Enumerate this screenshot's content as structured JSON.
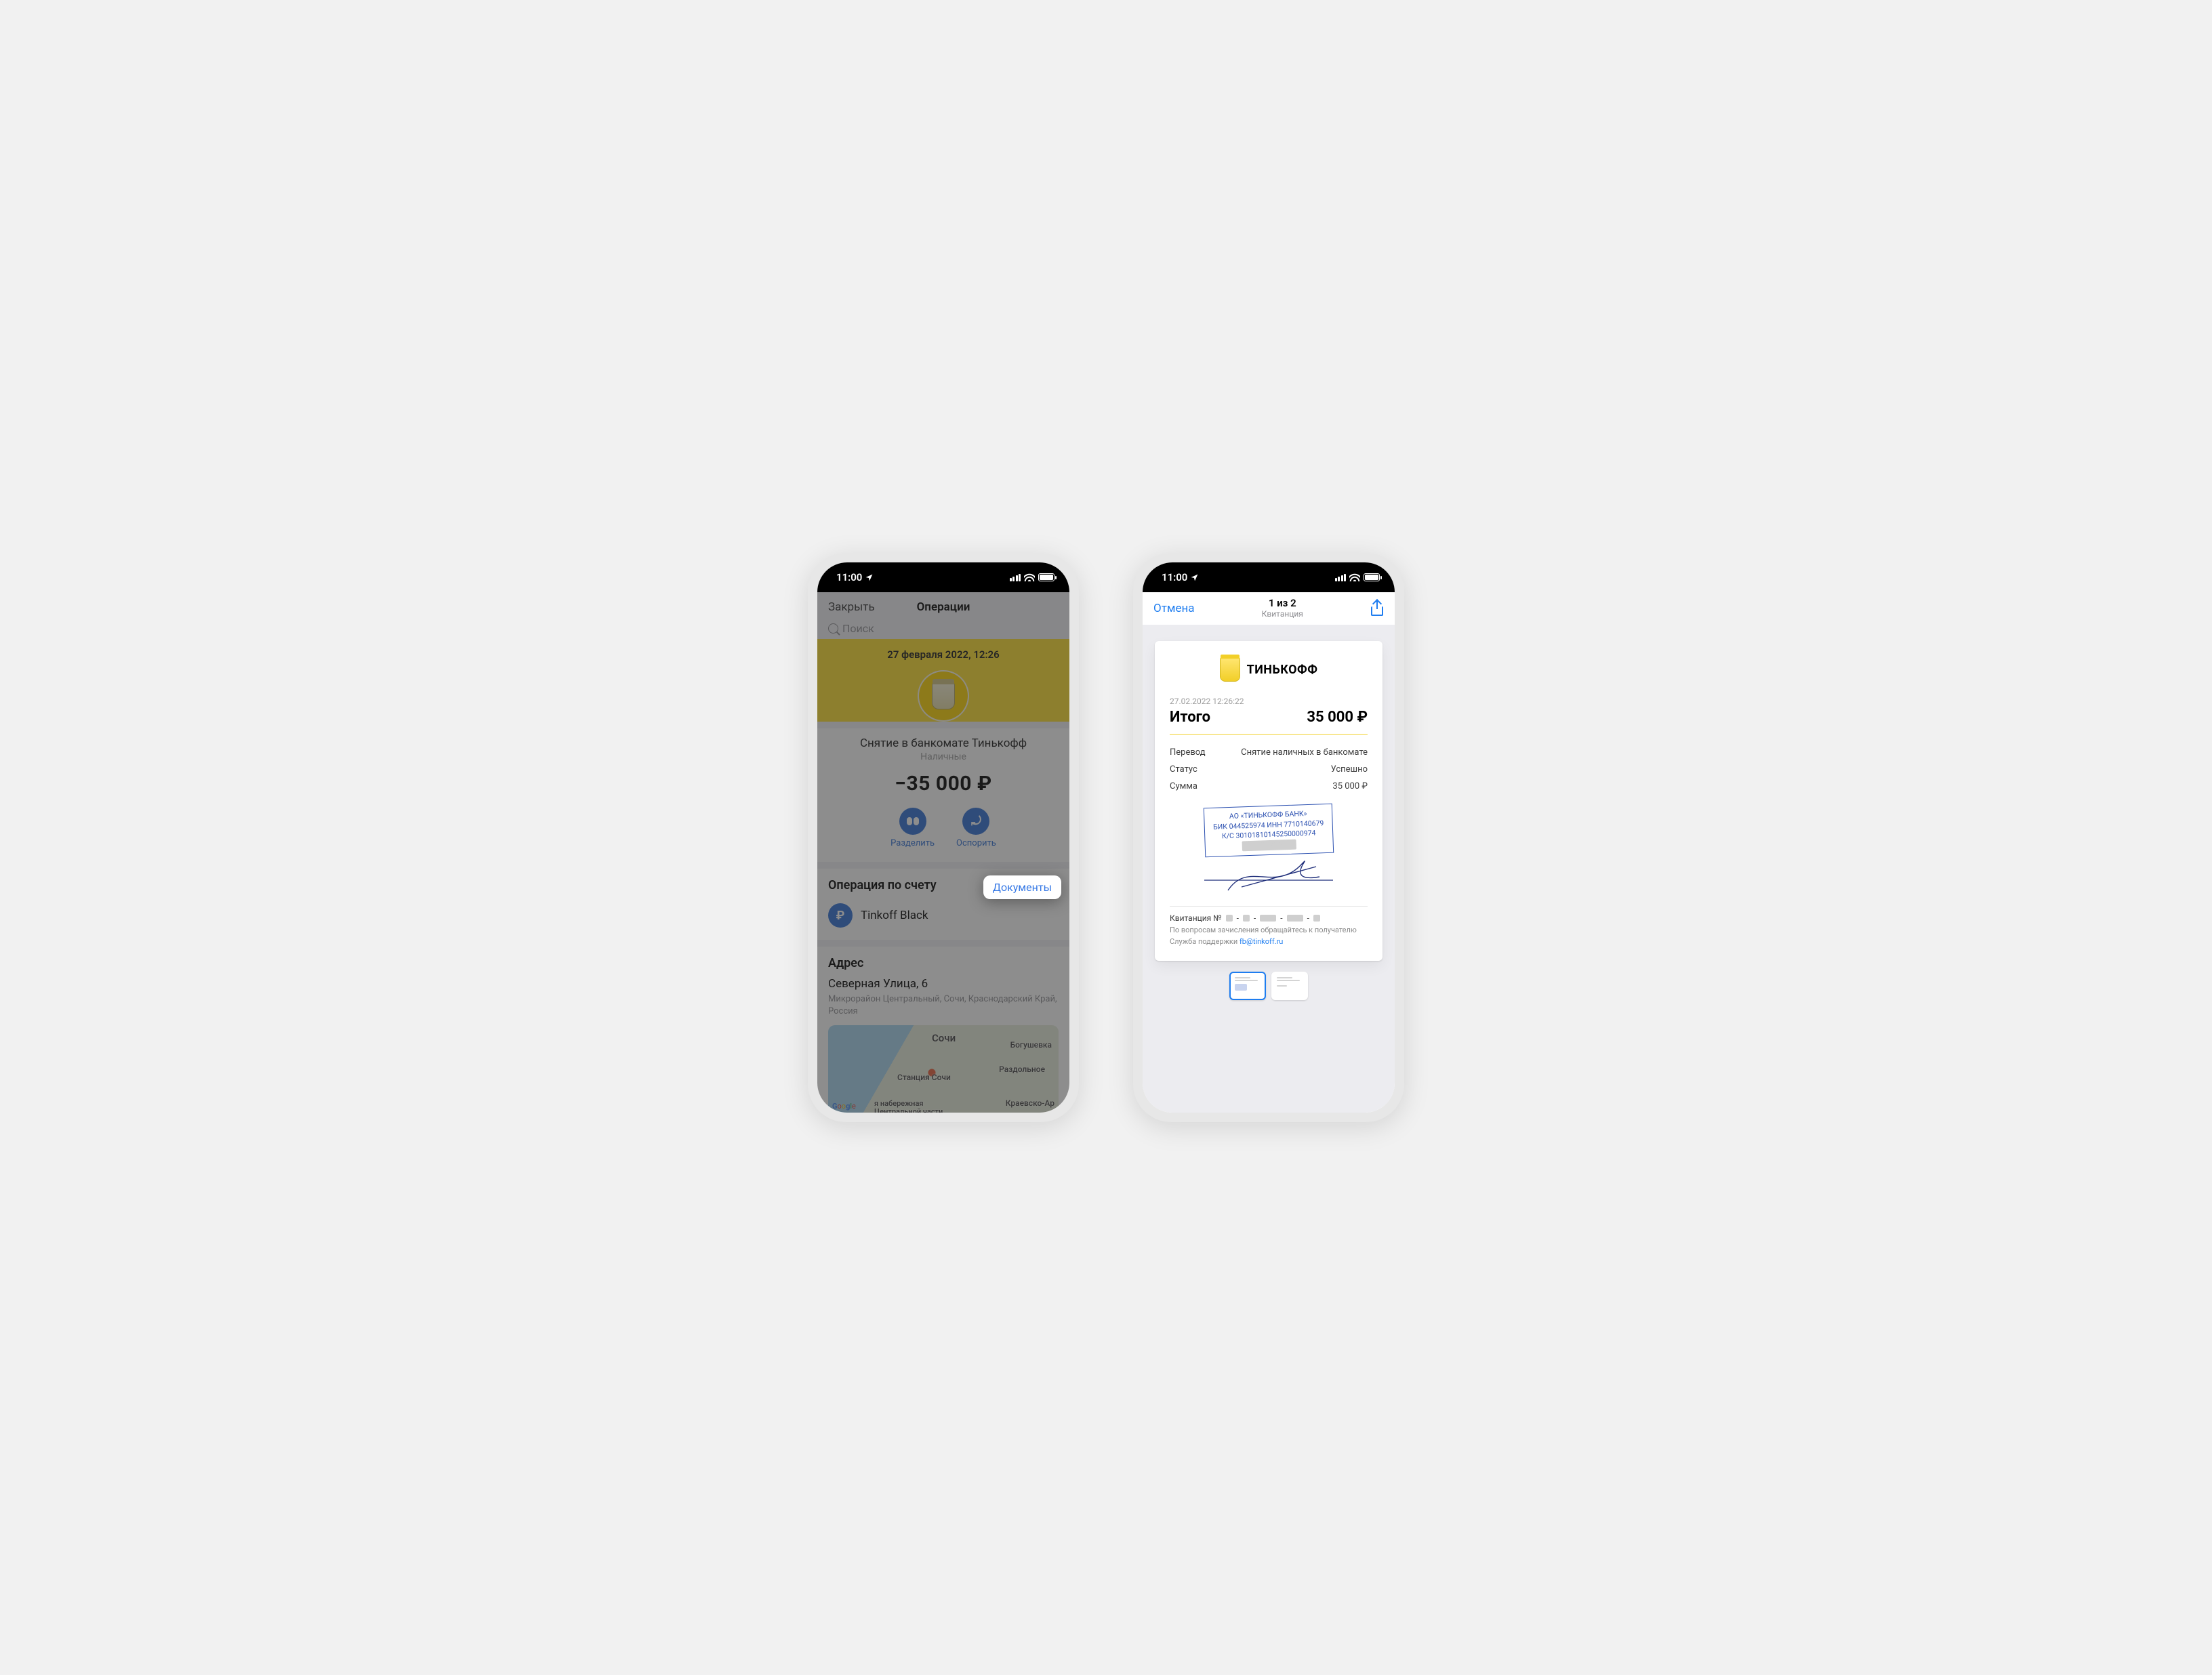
{
  "status": {
    "time": "11:00"
  },
  "phone_a": {
    "nav": {
      "back": "Закрыть",
      "title": "Операции"
    },
    "search_placeholder": "Поиск",
    "header_date": "27 февраля 2022, 12:26",
    "operation": {
      "title": "Снятие в банкомате Тинькофф",
      "subtitle": "Наличные",
      "amount": "−35 000 ₽",
      "actions": {
        "split": "Разделить",
        "dispute": "Оспорить"
      }
    },
    "account_section": {
      "title": "Операция по счету",
      "documents_button": "Документы",
      "account_name": "Tinkoff Black"
    },
    "address_section": {
      "title": "Адрес",
      "line1": "Северная Улица, 6",
      "line2": "Микрорайон Центральный, Сочи, Краснодарский Край, Россия"
    },
    "map": {
      "city": "Сочи",
      "labels": [
        "Богушевка",
        "Раздольное",
        "Станция Сочи",
        "Краевско-Ар"
      ],
      "long_label": "я набережная Центральной части",
      "attribution": "Google"
    }
  },
  "phone_b": {
    "nav": {
      "cancel": "Отмена",
      "counter": "1 из 2",
      "subtitle": "Квитанция"
    },
    "brand": "ТИНЬКОФФ",
    "receipt": {
      "timestamp": "27.02.2022  12:26:22",
      "total_label": "Итого",
      "total_amount": "35 000 ₽",
      "rows": [
        {
          "k": "Перевод",
          "v": "Снятие наличных в банкомате"
        },
        {
          "k": "Статус",
          "v": "Успешно"
        },
        {
          "k": "Сумма",
          "v": "35 000 ₽"
        }
      ],
      "stamp": {
        "line1": "АО «ТИНЬКОФФ БАНК»",
        "line2": "БИК 044525974   ИНН 7710140679",
        "line3": "К/С 30101810145250000974"
      },
      "footer": {
        "number_label": "Квитанция  №",
        "note": "По вопросам зачисления обращайтесь к получателю",
        "support_prefix": "Служба поддержки ",
        "support_email": "fb@tinkoff.ru"
      }
    }
  }
}
